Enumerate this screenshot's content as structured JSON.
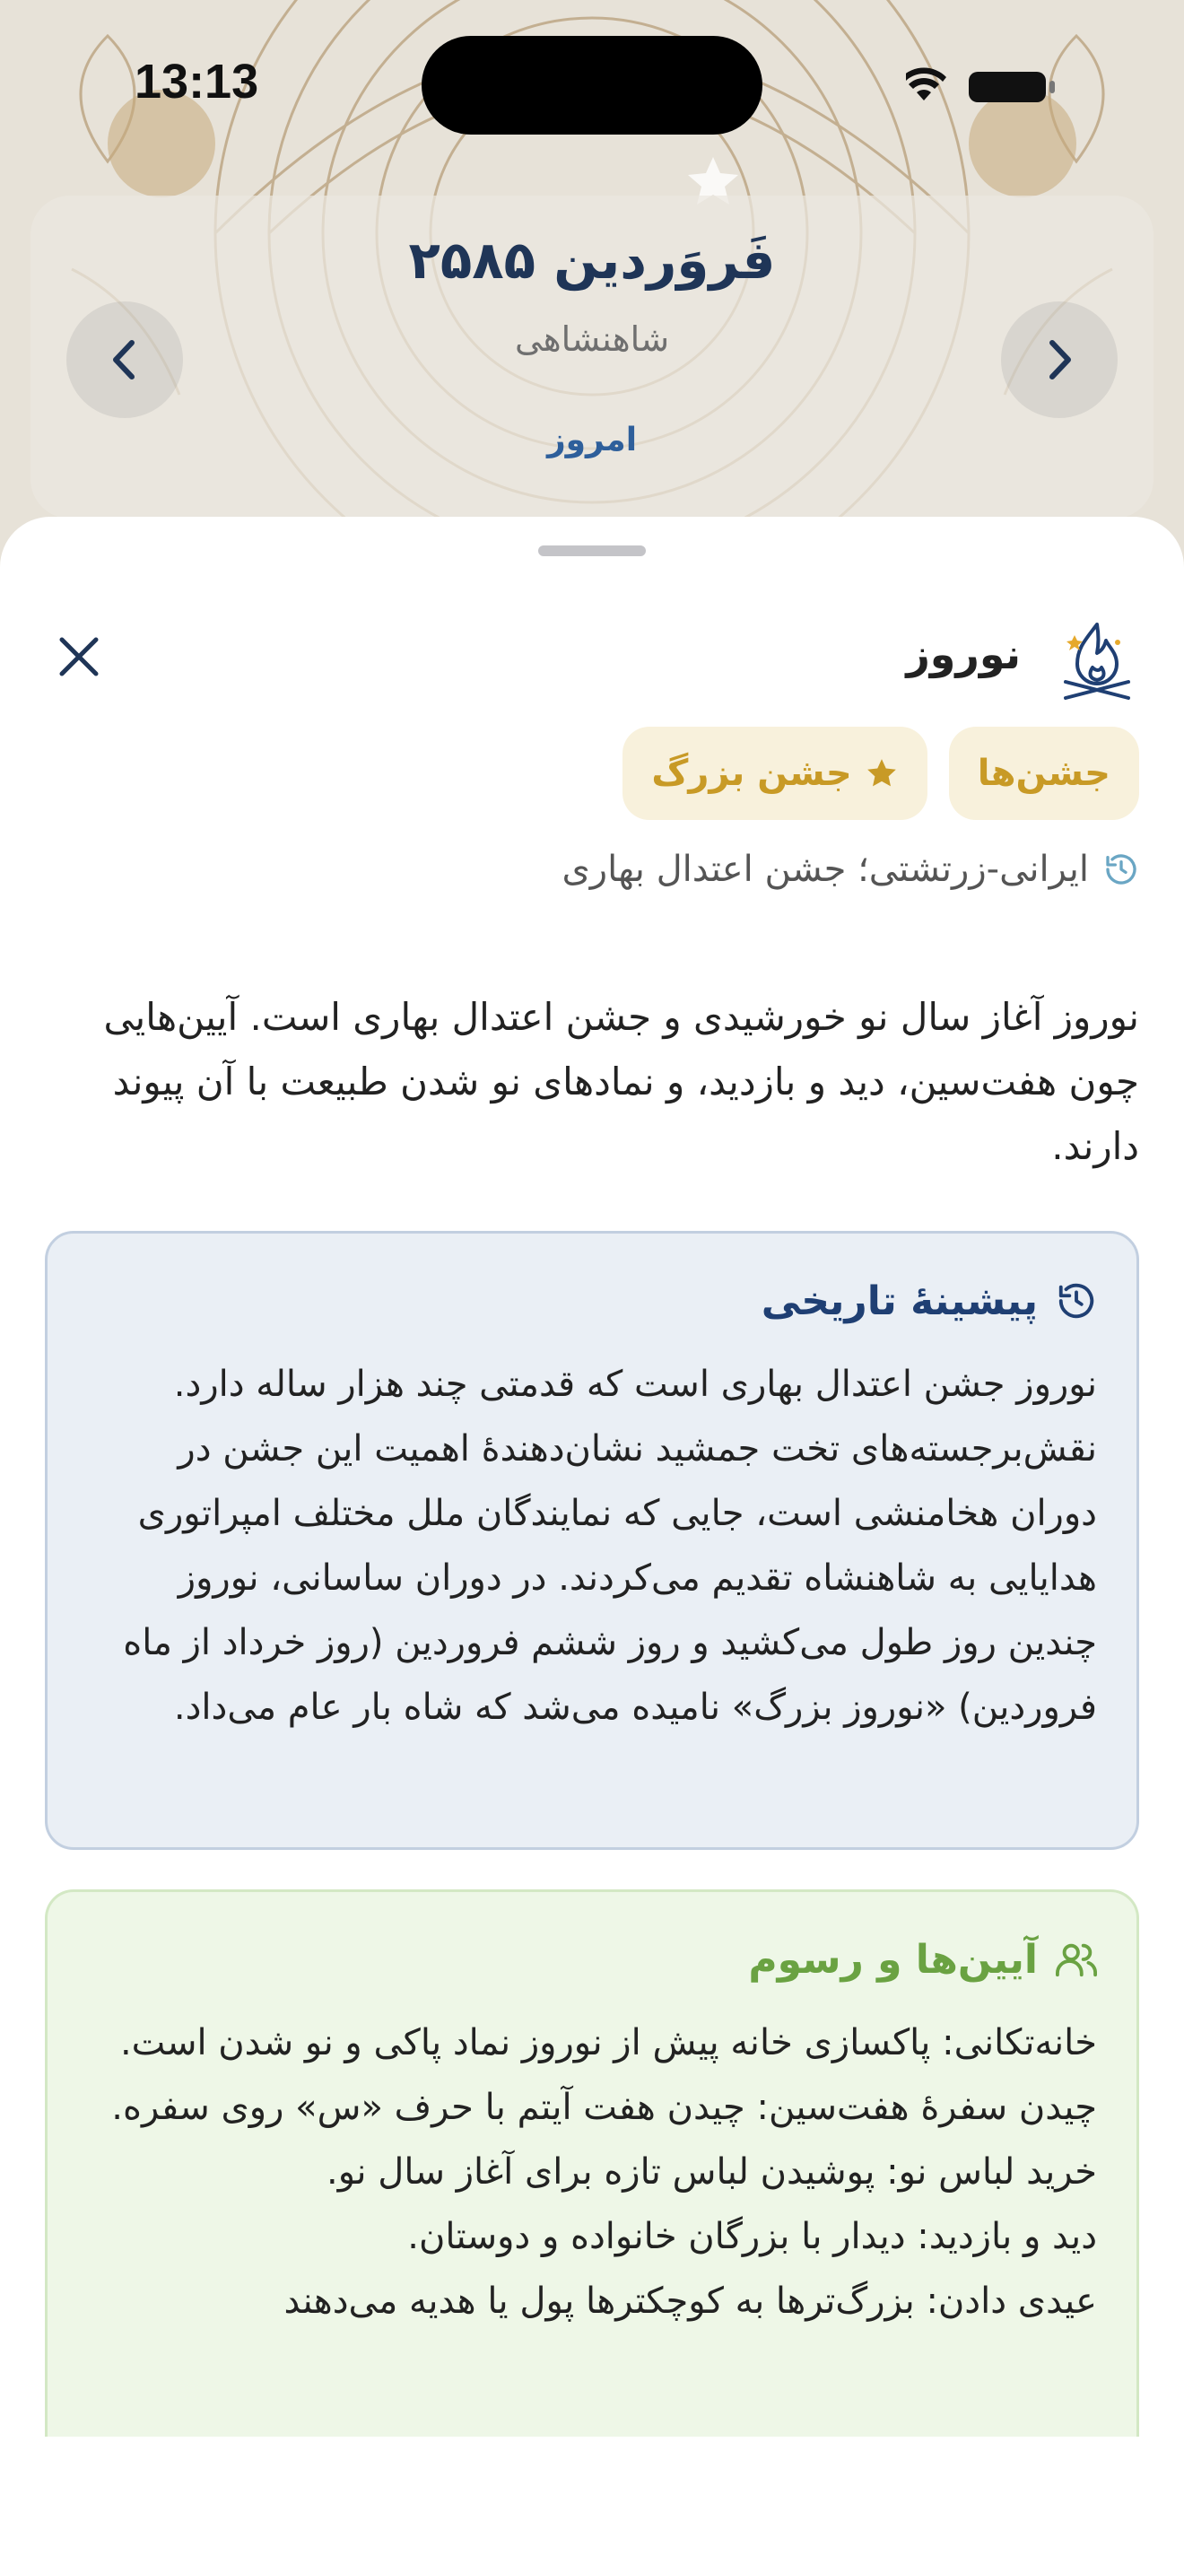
{
  "status_bar": {
    "time": "13:13"
  },
  "month_header": {
    "title": "فَروَردین ۲۵۸۵",
    "subtitle": "شاهنشاهی",
    "today_label": "امروز"
  },
  "event": {
    "title": "نوروز",
    "chips": [
      {
        "label": "جشن‌ها",
        "icon": "none"
      },
      {
        "label": "جشن بزرگ",
        "icon": "star-icon"
      }
    ],
    "origin": "ایرانی-زرتشتی؛ جشن اعتدال بهاری",
    "description": "نوروز آغاز سال نو خورشیدی و جشن اعتدال بهاری است. آیین‌هایی چون هفت‌سین، دید و بازدید، و نمادهای نو شدن طبیعت با آن پیوند دارند."
  },
  "history_card": {
    "title": "پیشینهٔ تاریخی",
    "body": "نوروز جشن اعتدال بهاری است که قدمتی چند هزار ساله دارد. نقش‌برجسته‌های تخت جمشید نشان‌دهندهٔ اهمیت این جشن در دوران هخامنشی است، جایی که نمایندگان ملل مختلف امپراتوری هدایایی به شاهنشاه تقدیم می‌کردند. در دوران ساسانی، نوروز چندین روز طول می‌کشید و روز ششم فروردین (روز خرداد از ماه فروردین) «نوروز بزرگ» نامیده می‌شد که شاه بار عام می‌داد."
  },
  "rituals_card": {
    "title": "آیین‌ها و رسوم",
    "items": [
      "خانه‌تکانی: پاکسازی خانه پیش از نوروز نماد پاکی و نو شدن است.",
      "چیدن سفرهٔ هفت‌سین: چیدن هفت آیتم با حرف «س» روی سفره.",
      "خرید لباس نو: پوشیدن لباس تازه برای آغاز سال نو.",
      "دید و بازدید: دیدار با بزرگان خانواده و دوستان.",
      "عیدی دادن: بزرگ‌ترها به کوچکترها پول یا هدیه می‌دهند"
    ]
  },
  "colors": {
    "accent_gold": "#c89a26",
    "chip_bg": "#f8f1dc",
    "navy": "#1f3557",
    "history_bg": "#eaeff5",
    "rituals_bg": "#eef7e7",
    "rituals_accent": "#6aa242"
  }
}
